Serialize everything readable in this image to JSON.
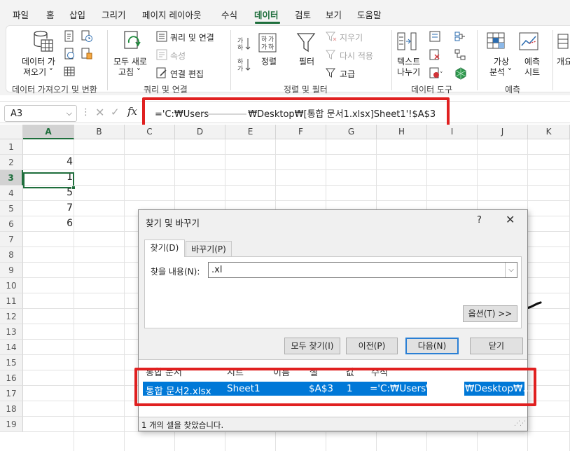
{
  "menu": {
    "tabs": [
      "파일",
      "홈",
      "삽입",
      "그리기",
      "페이지 레이아웃",
      "수식",
      "데이터",
      "검토",
      "보기",
      "도움말"
    ],
    "active": "데이터"
  },
  "ribbon": {
    "get_data": {
      "line1": "데이터 가",
      "line2": "져오기 ˅",
      "group": "데이터 가져오기 및 변환"
    },
    "queries": {
      "refresh_line1": "모두 새로",
      "refresh_line2": "고침 ˅",
      "queries_connections": "쿼리 및 연결",
      "properties": "속성",
      "edit_links": "연결 편집",
      "group": "쿼리 및 연결"
    },
    "sort_filter": {
      "sort": "정렬",
      "filter": "필터",
      "clear": "지우기",
      "reapply": "다시 적용",
      "advanced": "고급",
      "group": "정렬 및 필터"
    },
    "data_tools": {
      "text_line1": "텍스트",
      "text_line2": "나누기",
      "group": "데이터 도구"
    },
    "forecast": {
      "whatif_line1": "가상",
      "whatif_line2": "분석 ˅",
      "sheet_line1": "예측",
      "sheet_line2": "시트",
      "group": "예측"
    },
    "outline": {
      "line1": "개요"
    }
  },
  "formula_bar": {
    "name_box": "A3",
    "fx": "fx",
    "formula_start": "='C:₩Users",
    "formula_end": "₩Desktop₩[통합 문서1.xlsx]Sheet1'!$A$3"
  },
  "grid": {
    "columns": [
      "A",
      "B",
      "C",
      "D",
      "E",
      "F",
      "G",
      "H",
      "I",
      "J",
      "K"
    ],
    "rows": [
      "1",
      "2",
      "3",
      "4",
      "5",
      "6",
      "7",
      "8",
      "9",
      "10",
      "11",
      "12",
      "13",
      "14",
      "15",
      "16",
      "17",
      "18",
      "19"
    ],
    "values": [
      {
        "cell": "A2",
        "value": "4"
      },
      {
        "cell": "A3",
        "value": "1"
      },
      {
        "cell": "A4",
        "value": "5"
      },
      {
        "cell": "A5",
        "value": "7"
      },
      {
        "cell": "A6",
        "value": "6"
      }
    ]
  },
  "dialog": {
    "title": "찾기 및 바꾸기",
    "help": "?",
    "close": "✕",
    "tab_find": "찾기(D)",
    "tab_replace": "바꾸기(P)",
    "find_label": "찾을 내용(N):",
    "find_value": ".xl",
    "options_button": "옵션(T) >>",
    "find_all_button": "모두 찾기(I)",
    "prev_button": "이전(P)",
    "next_button": "다음(N)",
    "close_button": "닫기",
    "result_headers": [
      "통합 문서",
      "시트",
      "이름",
      "셀",
      "값",
      "수식"
    ],
    "result_row": {
      "workbook": "통합 문서2.xlsx",
      "sheet": "Sheet1",
      "cell": "$A$3",
      "value": "1",
      "formula_start": "='C:₩Users₩",
      "formula_end": "₩Desktop₩..."
    },
    "status": "1 개의 셀을 찾았습니다."
  },
  "colors": {
    "accent": "#1e6e3c",
    "highlight": "#e02020",
    "selection": "#0078d7"
  }
}
